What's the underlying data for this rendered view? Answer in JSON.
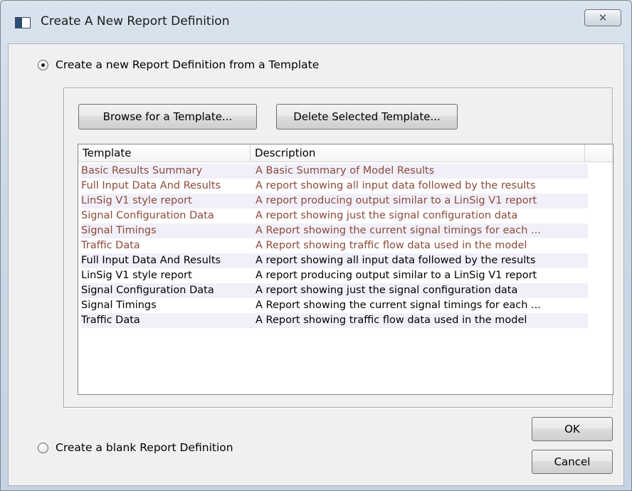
{
  "window": {
    "title": "Create A New Report Definition",
    "close_glyph": "✕"
  },
  "options": {
    "from_template_label": "Create a new Report Definition from a Template",
    "from_template_selected": true,
    "blank_label": "Create a blank Report Definition",
    "blank_selected": false
  },
  "toolbar": {
    "browse_label": "Browse for a Template...",
    "delete_label": "Delete Selected Template..."
  },
  "list": {
    "columns": [
      "Template",
      "Description"
    ],
    "rows": [
      {
        "template": "Basic Results Summary",
        "description": "A Basic Summary of Model Results",
        "kind": "user"
      },
      {
        "template": "Full Input Data And Results",
        "description": "A report showing all input data followed by the results",
        "kind": "user"
      },
      {
        "template": "LinSig V1 style report",
        "description": "A report producing output similar to a LinSig V1 report",
        "kind": "user"
      },
      {
        "template": "Signal Configuration Data",
        "description": "A report showing just the signal configuration data",
        "kind": "user"
      },
      {
        "template": "Signal Timings",
        "description": "A Report showing the current signal timings for each ...",
        "kind": "user"
      },
      {
        "template": "Traffic Data",
        "description": "A Report showing traffic flow data used in the model",
        "kind": "user"
      },
      {
        "template": "Full Input Data And Results",
        "description": "A report showing all input data followed by the results",
        "kind": "sys"
      },
      {
        "template": "LinSig V1 style report",
        "description": "A report producing output similar to a LinSig V1 report",
        "kind": "sys"
      },
      {
        "template": "Signal Configuration Data",
        "description": "A report showing just the signal configuration data",
        "kind": "sys"
      },
      {
        "template": "Signal Timings",
        "description": "A Report showing the current signal timings for each ...",
        "kind": "sys"
      },
      {
        "template": "Traffic Data",
        "description": "A Report showing traffic flow data used in the model",
        "kind": "sys"
      }
    ]
  },
  "dialog_buttons": {
    "ok_label": "OK",
    "cancel_label": "Cancel"
  },
  "colors": {
    "user_template_text": "#8b4a3a",
    "alt_row_background": "#f1f0fa"
  }
}
